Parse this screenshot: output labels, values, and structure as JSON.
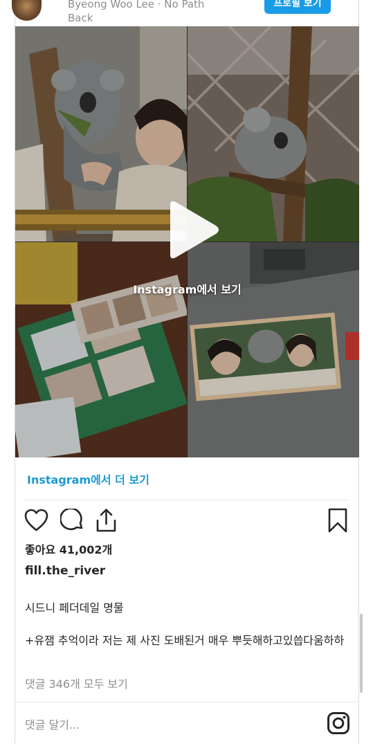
{
  "header": {
    "author_line1": "Byeong Woo Lee · No Path",
    "author_line2": "Back",
    "profile_button": "프로필 보기"
  },
  "media": {
    "overlay_label": "Instagram에서 보기"
  },
  "more_link": "Instagram에서 더 보기",
  "actions": {
    "like_icon": "heart-outline",
    "comment_icon": "speech-bubble",
    "share_icon": "share-upload",
    "save_icon": "bookmark-outline"
  },
  "post": {
    "likes": "좋아요 41,002개",
    "username": "fill.the_river",
    "caption_line1": "시드니 페더데일 명물",
    "caption_line2": "+유잼 추억이라 저는 제 사진 도배된거 매우 뿌듯해하고있씁다움하하",
    "view_comments": "댓글 346개 모두 보기",
    "comment_placeholder": "댓글 달기..."
  },
  "colors": {
    "link": "#1d9ad1",
    "button": "#1a9be6",
    "text": "#262626",
    "muted": "#8e8e8e"
  }
}
